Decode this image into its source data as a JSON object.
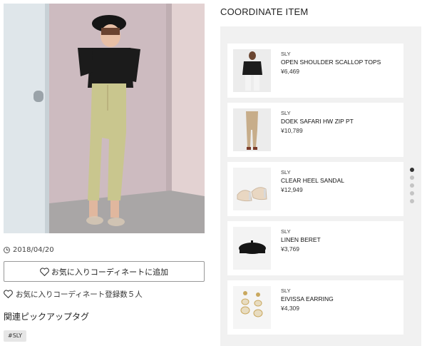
{
  "post": {
    "date": "2018/04/20",
    "favorite_button_label": "お気に入りコーディネートに追加",
    "favorite_count_text": "お気に入りコーディネート登録数５人",
    "related_tags_title": "関連ピックアップタグ",
    "tags": [
      "#SLY"
    ]
  },
  "coordinate": {
    "title": "COORDINATE ITEM",
    "items": [
      {
        "brand": "SLY",
        "name": "OPEN SHOULDER SCALLOP TOPS",
        "price": "¥6,469"
      },
      {
        "brand": "SLY",
        "name": "DOEK SAFARI HW ZIP PT",
        "price": "¥10,789"
      },
      {
        "brand": "SLY",
        "name": "CLEAR HEEL SANDAL",
        "price": "¥12,949"
      },
      {
        "brand": "SLY",
        "name": "LINEN BERET",
        "price": "¥3,769"
      },
      {
        "brand": "SLY",
        "name": "EIVISSA EARRING",
        "price": "¥4,309"
      }
    ],
    "pager_active_index": 0,
    "pager_count": 5
  }
}
